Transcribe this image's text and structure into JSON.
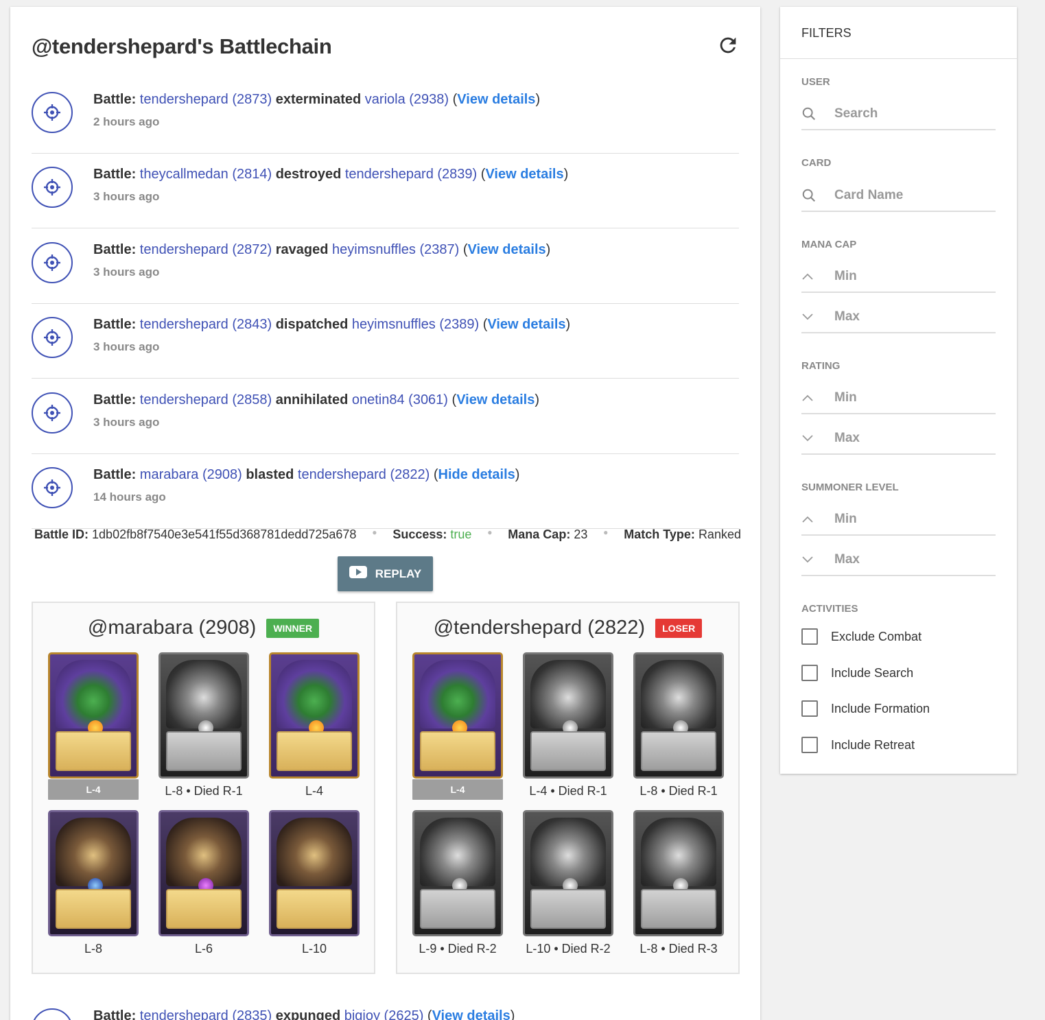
{
  "header": {
    "title": "@tendershepard's Battlechain"
  },
  "battles": [
    {
      "prefix": "Battle:",
      "p1": "tendershepard (2873)",
      "verb": "exterminated",
      "p2": "variola (2938)",
      "link": "View details",
      "time": "2 hours ago"
    },
    {
      "prefix": "Battle:",
      "p1": "theycallmedan (2814)",
      "verb": "destroyed",
      "p2": "tendershepard (2839)",
      "link": "View details",
      "time": "3 hours ago"
    },
    {
      "prefix": "Battle:",
      "p1": "tendershepard (2872)",
      "verb": "ravaged",
      "p2": "heyimsnuffles (2387)",
      "link": "View details",
      "time": "3 hours ago"
    },
    {
      "prefix": "Battle:",
      "p1": "tendershepard (2843)",
      "verb": "dispatched",
      "p2": "heyimsnuffles (2389)",
      "link": "View details",
      "time": "3 hours ago"
    },
    {
      "prefix": "Battle:",
      "p1": "tendershepard (2858)",
      "verb": "annihilated",
      "p2": "onetin84 (3061)",
      "link": "View details",
      "time": "3 hours ago"
    },
    {
      "prefix": "Battle:",
      "p1": "marabara (2908)",
      "verb": "blasted",
      "p2": "tendershepard (2822)",
      "link": "Hide details",
      "time": "14 hours ago"
    },
    {
      "prefix": "Battle:",
      "p1": "tendershepard (2835)",
      "verb": "expunged",
      "p2": "bigjoy (2625)",
      "link": "View details",
      "time": ""
    }
  ],
  "details": {
    "battle_id_label": "Battle ID:",
    "battle_id": "1db02fb8f7540e3e541f55d368781dedd725a678",
    "success_label": "Success:",
    "success": "true",
    "mana_label": "Mana Cap:",
    "mana": "23",
    "match_label": "Match Type:",
    "match": "Ranked",
    "replay_label": "REPLAY"
  },
  "teams": [
    {
      "name": "@marabara (2908)",
      "badge": "WINNER",
      "badge_type": "win",
      "cards": [
        {
          "label": "L-4",
          "style": "gold",
          "gem": "gold",
          "summoner": true
        },
        {
          "label": "L-8 • Died R-1",
          "style": "gray",
          "gem": "gray"
        },
        {
          "label": "L-4",
          "style": "gold",
          "gem": "gold"
        },
        {
          "label": "L-8",
          "style": "purple",
          "gem": "blue"
        },
        {
          "label": "L-6",
          "style": "purple",
          "gem": "violet"
        },
        {
          "label": "L-10",
          "style": "purple",
          "gem": "gray"
        }
      ]
    },
    {
      "name": "@tendershepard (2822)",
      "badge": "LOSER",
      "badge_type": "lose",
      "cards": [
        {
          "label": "L-4",
          "style": "gold",
          "gem": "gold",
          "summoner": true
        },
        {
          "label": "L-4 • Died R-1",
          "style": "gray",
          "gem": "gray"
        },
        {
          "label": "L-8 • Died R-1",
          "style": "gray",
          "gem": "gray"
        },
        {
          "label": "L-9 • Died R-2",
          "style": "gray",
          "gem": "gray"
        },
        {
          "label": "L-10 • Died R-2",
          "style": "gray",
          "gem": "gray"
        },
        {
          "label": "L-8 • Died R-3",
          "style": "gray",
          "gem": "gray"
        }
      ]
    }
  ],
  "filters": {
    "title": "FILTERS",
    "user": {
      "label": "USER",
      "placeholder": "Search"
    },
    "card": {
      "label": "CARD",
      "placeholder": "Card Name"
    },
    "mana_cap": {
      "label": "MANA CAP",
      "min": "Min",
      "max": "Max"
    },
    "rating": {
      "label": "RATING",
      "min": "Min",
      "max": "Max"
    },
    "summoner_level": {
      "label": "SUMMONER LEVEL",
      "min": "Min",
      "max": "Max"
    },
    "activities": {
      "label": "ACTIVITIES",
      "options": [
        "Exclude Combat",
        "Include Search",
        "Include Formation",
        "Include Retreat"
      ]
    }
  },
  "colors": {
    "link": "#3f51b5",
    "action_link": "#2a7de1",
    "success": "#4caf50",
    "winner": "#4caf50",
    "loser": "#e53935",
    "replay": "#5d7a88"
  },
  "icons": {
    "battle": "crosshair-icon",
    "refresh": "refresh-icon",
    "search": "search-icon",
    "min": "chevron-up-icon",
    "max": "chevron-down-icon",
    "replay": "video-play-icon"
  }
}
